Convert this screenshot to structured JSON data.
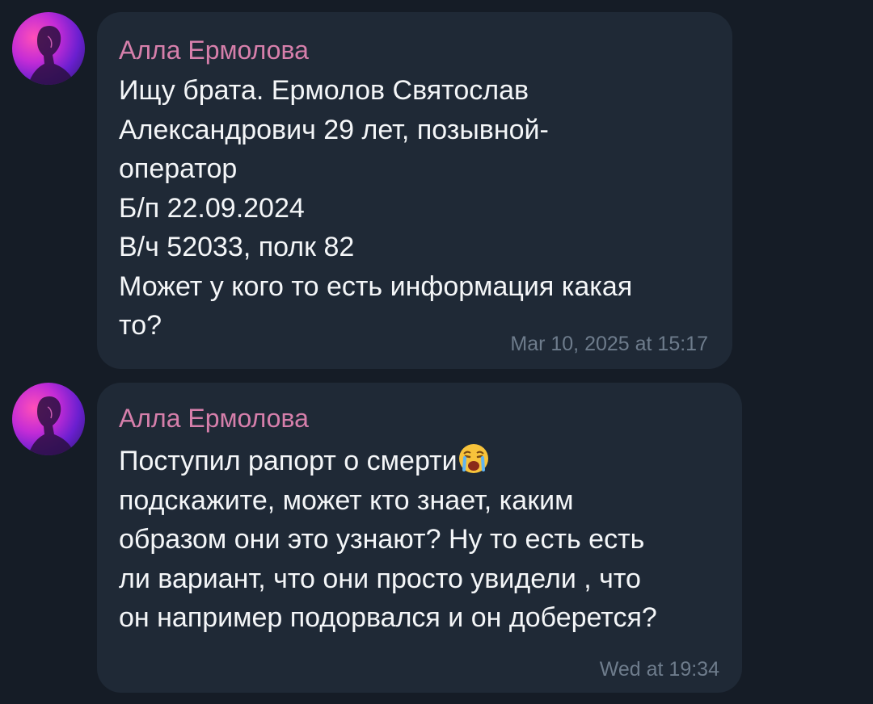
{
  "messages": [
    {
      "sender": "Алла Ермолова",
      "text": "Ищу брата. Ермолов Святослав\nАлександрович 29 лет, позывной-\nоператор\nБ/п 22.09.2024\nВ/ч 52033, полк 82\nМожет у кого то есть информация какая\nто?",
      "time": "Mar 10, 2025 at 15:17",
      "avatar": "avatar-icon"
    },
    {
      "sender": "Алла Ермолова",
      "text_before_emoji": "Поступил рапорт о смерти",
      "emoji": "crying-face-emoji",
      "text_after_emoji": "\nподскажите, может кто знает, каким\nобразом они это узнают? Ну то есть есть\nли вариант, что они просто увидели , что\nон например подорвался и он доберется?",
      "time": "Wed at 19:34",
      "avatar": "avatar-icon"
    }
  ],
  "colors": {
    "background": "#151c26",
    "bubble": "#1f2936",
    "sender_name": "#d67fab",
    "message_text": "#f4f6f8",
    "timestamp": "#6e7c8c"
  }
}
